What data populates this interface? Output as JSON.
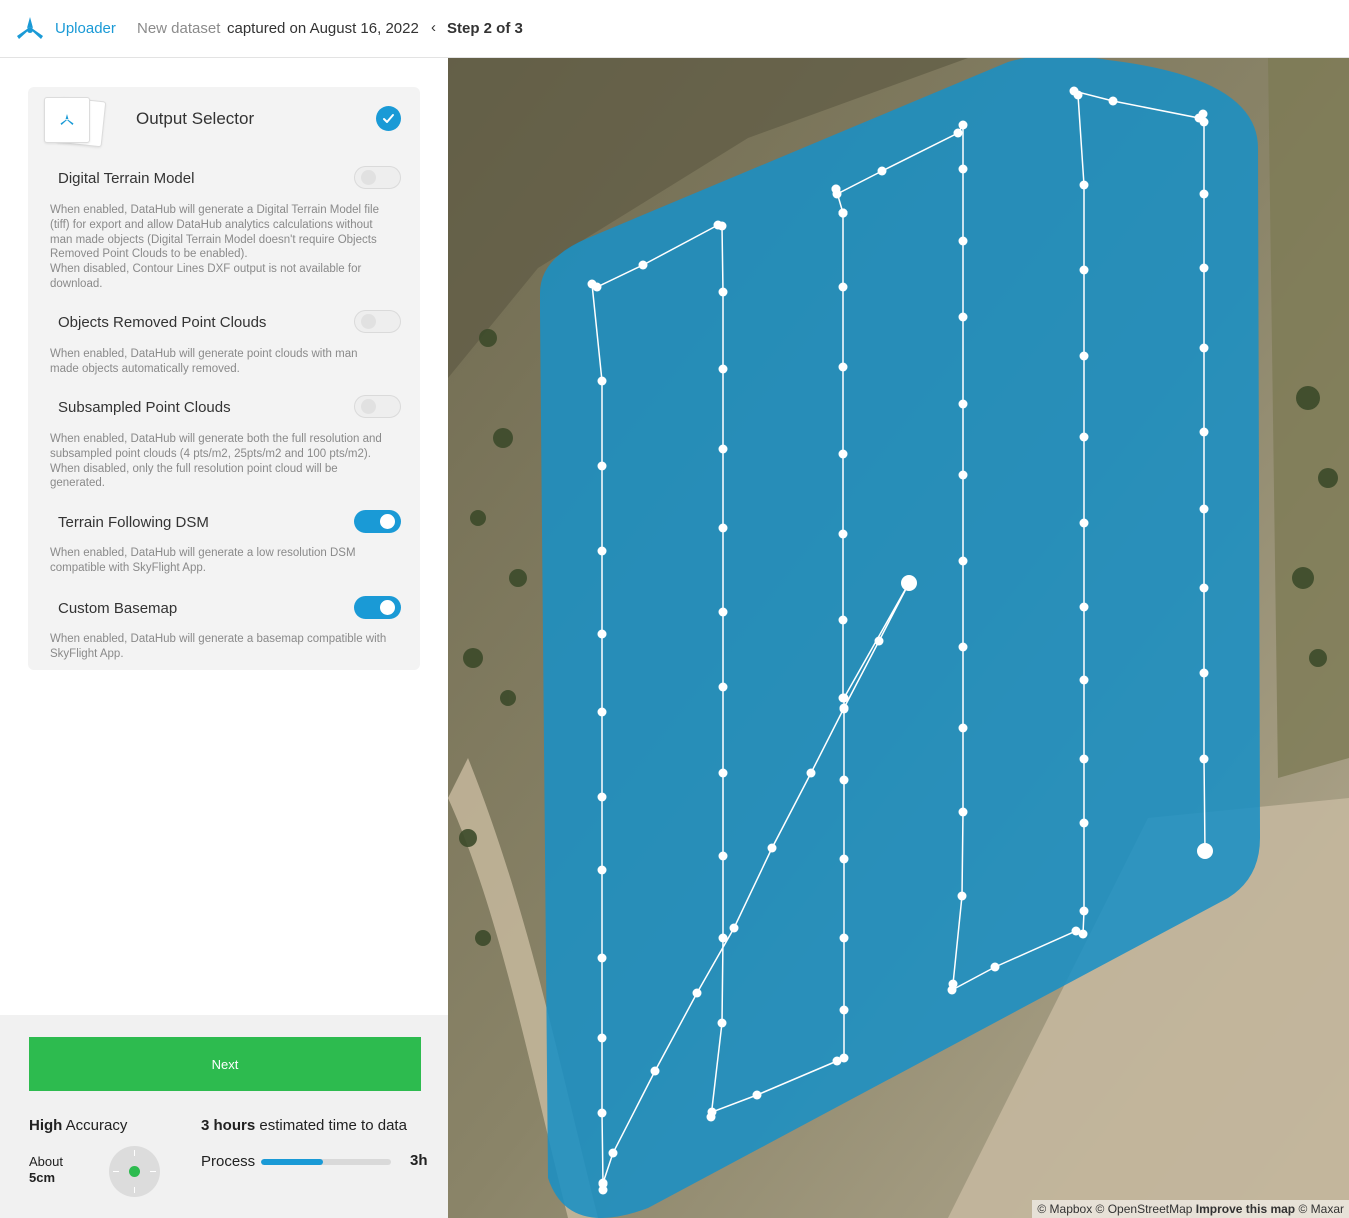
{
  "header": {
    "brand": "Uploader",
    "dataset_name": "New dataset",
    "captured": "captured on August 16, 2022",
    "step": "Step 2 of 3"
  },
  "card": {
    "title": "Output Selector",
    "options": [
      {
        "title": "Digital Terrain Model",
        "enabled": false,
        "description": [
          "When enabled, DataHub will generate a Digital Terrain Model file",
          "(tiff) for export and allow DataHub analytics calculations without",
          "man made objects (Digital Terrain Model doesn't require Objects",
          "Removed Point Clouds to be enabled).",
          "When disabled, Contour Lines DXF output is not available for",
          "download."
        ]
      },
      {
        "title": "Objects Removed Point Clouds",
        "enabled": false,
        "description": [
          "When enabled, DataHub will generate point clouds with man",
          "made objects automatically removed."
        ]
      },
      {
        "title": "Subsampled Point Clouds",
        "enabled": false,
        "description": [
          "When enabled, DataHub will generate both the full resolution and",
          "subsampled point clouds (4 pts/m2, 25pts/m2 and 100 pts/m2).",
          "When disabled, only the full resolution point cloud will be",
          "generated."
        ]
      },
      {
        "title": "Terrain Following DSM",
        "enabled": true,
        "description": [
          "When enabled, DataHub will generate a low resolution DSM",
          "compatible with SkyFlight App."
        ]
      },
      {
        "title": "Custom Basemap",
        "enabled": true,
        "description": [
          "When enabled, DataHub will generate a basemap compatible with",
          "SkyFlight App."
        ]
      }
    ]
  },
  "footer": {
    "next_label": "Next",
    "accuracy_strong": "High",
    "accuracy_rest": " Accuracy",
    "about_label": "About",
    "about_value": "5cm",
    "time_strong": "3 hours",
    "time_rest": " estimated time to data",
    "process_label": "Process",
    "process_progress_percent": 48,
    "process_time": "3h"
  },
  "map": {
    "attribution_plain": "© Mapbox © OpenStreetMap ",
    "attribution_bold": "Improve this map",
    "attribution_tail": " © Maxar"
  },
  "colors": {
    "accent": "#1a9ad6",
    "next_button": "#2dbb4f",
    "coverage": "#1a8fc4"
  },
  "icons": {
    "logo": "uploader-logo-icon",
    "back": "chevron-left-icon",
    "check": "checkmark-icon",
    "target": "gps-target-icon"
  }
}
